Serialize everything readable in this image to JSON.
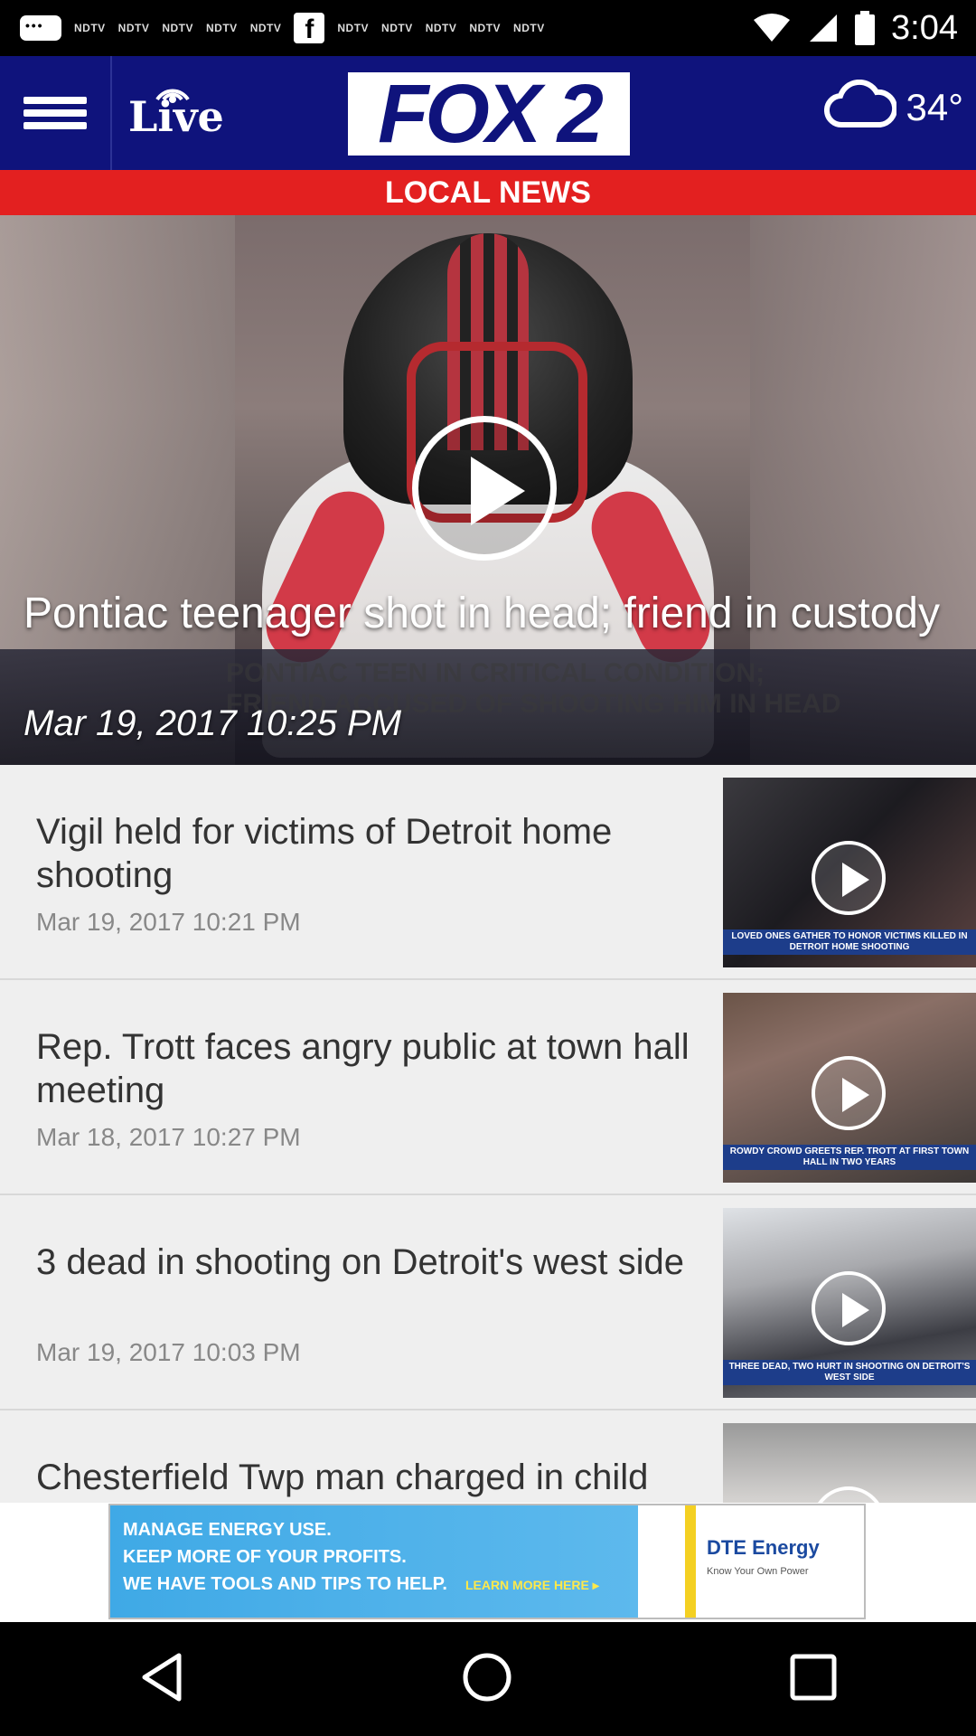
{
  "status_bar": {
    "ndtv_label": "NDTV",
    "time": "3:04"
  },
  "header": {
    "live_label": "Live",
    "logo_text": "FOX 2",
    "weather_temp": "34°"
  },
  "section": {
    "title": "LOCAL NEWS"
  },
  "hero": {
    "title": "Pontiac teenager shot in head; friend in custody",
    "date": "Mar 19, 2017 10:25 PM",
    "video_caption_line1": "PONTIAC TEEN IN CRITICAL CONDITION;",
    "video_caption_line2": "FRIEND ACCUSED OF SHOOTING HIM IN HEAD"
  },
  "news": [
    {
      "title": "Vigil held for victims of Detroit home shooting",
      "date": "Mar 19, 2017 10:21 PM",
      "thumb_caption": "LOVED ONES GATHER TO HONOR VICTIMS KILLED IN DETROIT HOME SHOOTING"
    },
    {
      "title": "Rep. Trott faces angry public at town hall meeting",
      "date": "Mar 18, 2017 10:27 PM",
      "thumb_caption": "ROWDY CROWD GREETS REP. TROTT AT FIRST TOWN HALL IN TWO YEARS"
    },
    {
      "title": "3 dead in shooting on Detroit's west side",
      "date": "Mar 19, 2017 10:03 PM",
      "thumb_caption": "THREE DEAD, TWO HURT IN SHOOTING ON DETROIT'S WEST SIDE"
    },
    {
      "title": "Chesterfield Twp man charged in child"
    }
  ],
  "ad": {
    "line1": "MANAGE ENERGY USE.",
    "line2": "KEEP MORE OF YOUR PROFITS.",
    "line3": "WE HAVE TOOLS AND TIPS TO HELP.",
    "cta": "LEARN MORE HERE ▸",
    "brand": "DTE Energy",
    "tagline": "Know Your Own Power"
  },
  "colors": {
    "header_bg": "#0f137c",
    "section_bg": "#e32020",
    "list_bg": "#efefef"
  }
}
